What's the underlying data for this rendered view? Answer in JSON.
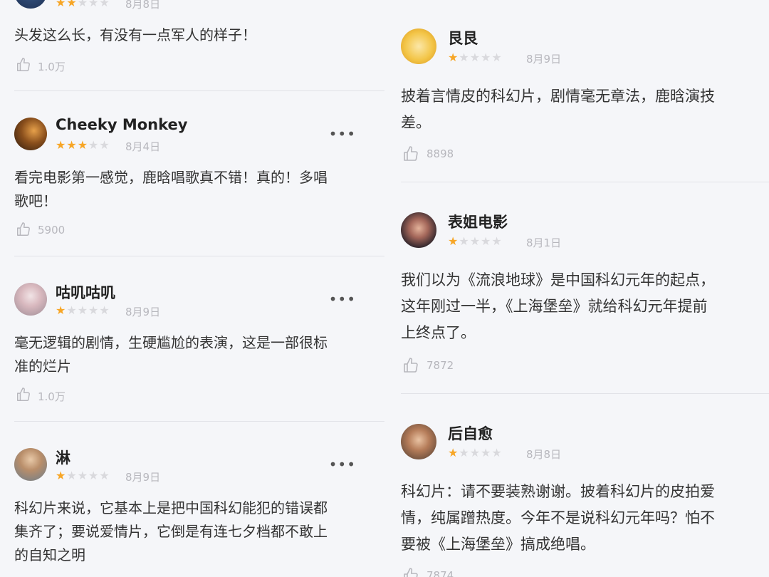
{
  "left": {
    "top_partial": {
      "stars": 2,
      "date": "8月8日",
      "text": "头发这么长，有没有一点军人的样子！",
      "likes": "1.0万"
    },
    "reviews": [
      {
        "name": "Cheeky Monkey",
        "stars": 3,
        "date": "8月4日",
        "lines": [
          "看完电影第一感觉，鹿晗唱歌真不错！真的！多唱",
          "歌吧！"
        ],
        "likes": "5900"
      },
      {
        "name": "咕叽咕叽",
        "stars": 1,
        "date": "8月9日",
        "lines": [
          "毫无逻辑的剧情，生硬尴尬的表演，这是一部很标",
          "准的烂片"
        ],
        "likes": "1.0万"
      },
      {
        "name": "淋",
        "stars": 1,
        "date": "8月9日",
        "lines": [
          "科幻片来说，它基本上是把中国科幻能犯的错误都",
          "集齐了；要说爱情片，它倒是有连七夕档都不敢上",
          "的自知之明"
        ]
      }
    ]
  },
  "right": {
    "reviews": [
      {
        "name": "艮艮",
        "stars": 1,
        "date": "8月9日",
        "lines": [
          "披着言情皮的科幻片，剧情毫无章法，鹿晗演技",
          "差。"
        ],
        "likes": "8898"
      },
      {
        "name": "表姐电影",
        "stars": 1,
        "date": "8月1日",
        "lines": [
          "我们以为《流浪地球》是中国科幻元年的起点，",
          "这年刚过一半，《上海堡垒》就给科幻元年提前",
          "上终点了。"
        ],
        "likes": "7872"
      },
      {
        "name": "后自愈",
        "stars": 1,
        "date": "8月8日",
        "lines": [
          "科幻片：请不要装熟谢谢。披着科幻片的皮拍爱",
          "情，纯属蹭热度。今年不是说科幻元年吗？怕不",
          "要被《上海堡垒》搞成绝唱。"
        ],
        "likes": "7874"
      }
    ]
  },
  "more_label": "•••",
  "colors": {
    "star_on": "#f7a626",
    "star_off": "#d9d9dd",
    "meta": "#b7b7bd",
    "background": "#f5f6f9"
  }
}
